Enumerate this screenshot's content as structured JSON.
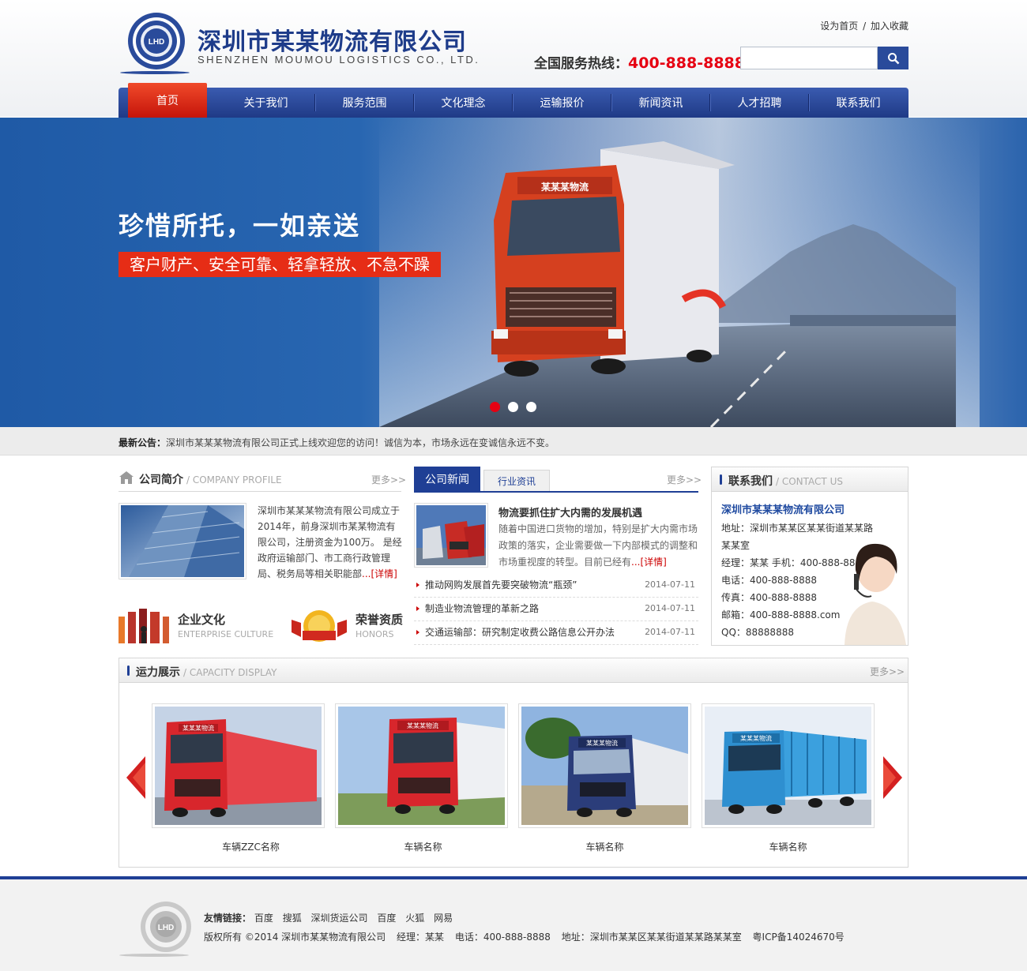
{
  "header": {
    "company_cn": "深圳市某某物流有限公司",
    "company_en": "SHENZHEN MOUMOU LOGISTICS CO., LTD.",
    "set_home": "设为首页",
    "sep": "/",
    "bookmark": "加入收藏",
    "hotline_label": "全国服务热线：",
    "hotline_number": "400-888-8888",
    "search_placeholder": "",
    "logo_text": "LHD"
  },
  "nav": [
    {
      "label": "首页",
      "active": true
    },
    {
      "label": "关于我们"
    },
    {
      "label": "服务范围"
    },
    {
      "label": "文化理念"
    },
    {
      "label": "运输报价"
    },
    {
      "label": "新闻资讯"
    },
    {
      "label": "人才招聘"
    },
    {
      "label": "联系我们"
    }
  ],
  "banner": {
    "title": "珍惜所托，一如亲送",
    "subtitle": "客户财产、安全可靠、轻拿轻放、不急不躁",
    "truck_sign": "某某某物流",
    "slides": 3,
    "active_slide": 1
  },
  "notice": {
    "label": "最新公告：",
    "text": "深圳市某某某物流有限公司正式上线欢迎您的访问！诚信为本，市场永远在变诚信永远不变。"
  },
  "profile": {
    "title": "公司简介",
    "title_en": "/ COMPANY PROFILE",
    "more": "更多>>",
    "text": "深圳市某某某物流有限公司成立于2014年，前身深圳市某某物流有限公司，注册资金为100万。 是经政府运输部门、市工商行政管理局、税务局等相关职能部",
    "detail": "...[详情]"
  },
  "culture": {
    "title": "企业文化",
    "en": "ENTERPRISE CULTURE"
  },
  "honor": {
    "title": "荣誉资质",
    "en": "HONORS"
  },
  "news": {
    "tab_active": "公司新闻",
    "tab_other": "行业资讯",
    "more": "更多>>",
    "headline": "物流要抓住扩大内需的发展机遇",
    "summary": "随着中国进口货物的增加，特别是扩大内需市场政策的落实，企业需要做一下内部模式的调整和市场重视度的转型。目前已经有",
    "detail": "...[详情]",
    "items": [
      {
        "title": "推动网购发展首先要突破物流“瓶颈”",
        "date": "2014-07-11"
      },
      {
        "title": "制造业物流管理的革新之路",
        "date": "2014-07-11"
      },
      {
        "title": "交通运输部：研究制定收费公路信息公开办法",
        "date": "2014-07-11"
      }
    ]
  },
  "contact": {
    "title": "联系我们",
    "title_en": "/ CONTACT US",
    "company": "深圳市某某某物流有限公司",
    "address": "地址：深圳市某某区某某街道某某路某某室",
    "manager": "经理：某某  手机：400-888-8888",
    "phone": "电话：400-888-8888",
    "fax": "传真：400-888-8888",
    "email": "邮箱：400-888-8888.com",
    "qq": "QQ：88888888"
  },
  "capacity": {
    "title": "运力展示",
    "title_en": "/ CAPACITY DISPLAY",
    "more": "更多>>",
    "vehicles": [
      {
        "name": "车辆ZZC名称",
        "color": "#d8262c",
        "sign": "某某某物流"
      },
      {
        "name": "车辆名称",
        "color": "#d8262c",
        "sign": "某某某物流"
      },
      {
        "name": "车辆名称",
        "color": "#2b3d7a",
        "sign": "某某某物流"
      },
      {
        "name": "车辆名称",
        "color": "#2e8fd0",
        "sign": "某某某物流"
      }
    ]
  },
  "footer": {
    "links_label": "友情链接：",
    "links": [
      "百度",
      "搜狐",
      "深圳货运公司",
      "百度",
      "火狐",
      "网易"
    ],
    "copyright": "版权所有 ©2014 深圳市某某物流有限公司",
    "manager": "经理：某某",
    "phone": "电话：400-888-8888",
    "address": "地址：深圳市某某区某某街道某某路某某室",
    "icp": "粤ICP备14024670号"
  },
  "colors": {
    "brand_blue": "#1f3f95",
    "accent_red": "#e60012"
  }
}
